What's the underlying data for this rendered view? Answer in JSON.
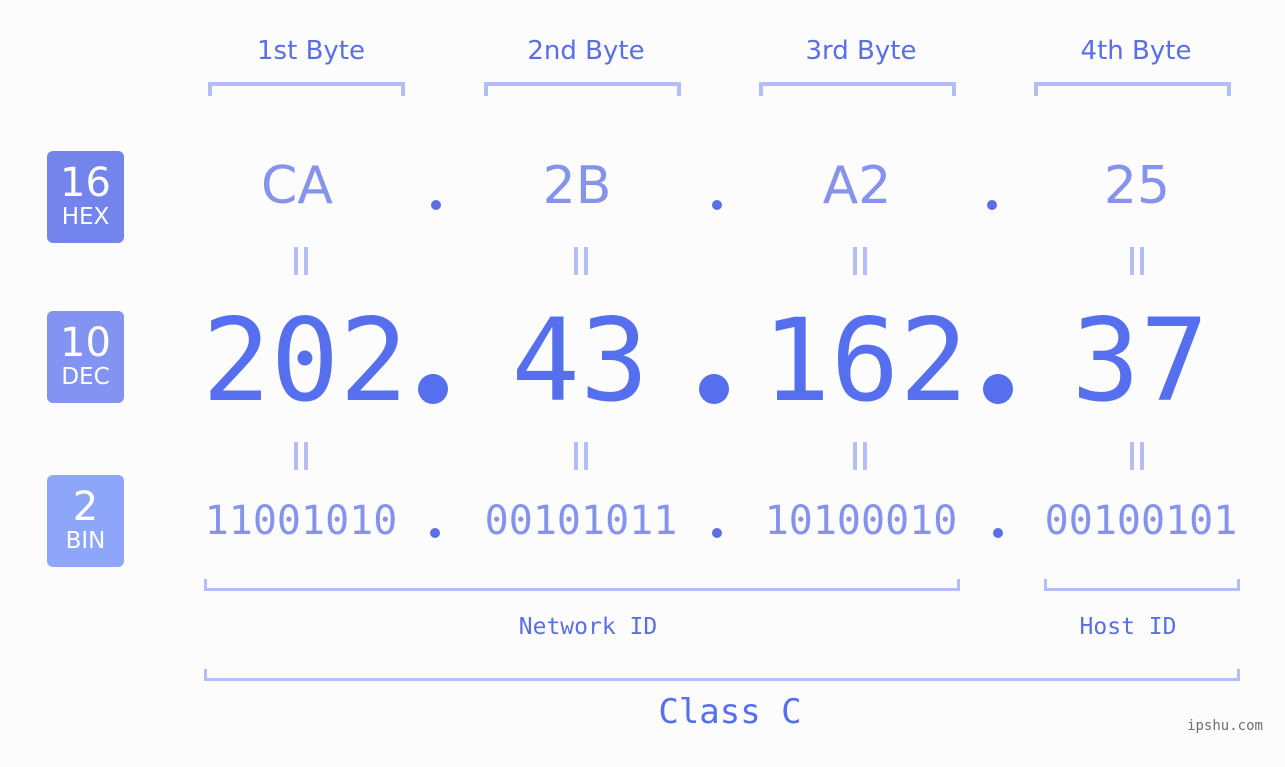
{
  "colors": {
    "background": "#fbfcfb",
    "accent": "#566fee",
    "light_value": "#8593ec",
    "bracket": "#b3bdf8",
    "badge_hex": "#7384ec",
    "badge_dec": "#8393f1",
    "badge_bin": "#8ea6fa",
    "watermark": "#707070"
  },
  "byte_headers": [
    "1st Byte",
    "2nd Byte",
    "3rd Byte",
    "4th Byte"
  ],
  "badges": {
    "hex": {
      "num": "16",
      "base": "HEX"
    },
    "dec": {
      "num": "10",
      "base": "DEC"
    },
    "bin": {
      "num": "2",
      "base": "BIN"
    }
  },
  "ip": {
    "hex": [
      "CA",
      "2B",
      "A2",
      "25"
    ],
    "dec": [
      "202",
      "43",
      "162",
      "37"
    ],
    "bin": [
      "11001010",
      "00101011",
      "10100010",
      "00100101"
    ],
    "separator": "."
  },
  "segments": {
    "network_id": "Network ID",
    "host_id": "Host ID",
    "class": "Class C"
  },
  "watermark": "ipshu.com"
}
